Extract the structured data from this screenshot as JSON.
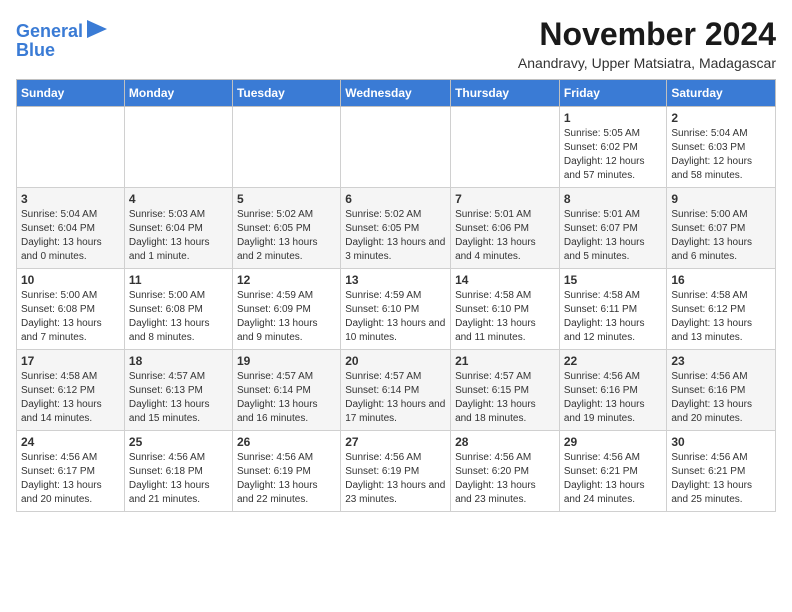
{
  "logo": {
    "line1": "General",
    "line2": "Blue"
  },
  "title": "November 2024",
  "location": "Anandravy, Upper Matsiatra, Madagascar",
  "headers": [
    "Sunday",
    "Monday",
    "Tuesday",
    "Wednesday",
    "Thursday",
    "Friday",
    "Saturday"
  ],
  "weeks": [
    [
      {
        "day": "",
        "sunrise": "",
        "sunset": "",
        "daylight": ""
      },
      {
        "day": "",
        "sunrise": "",
        "sunset": "",
        "daylight": ""
      },
      {
        "day": "",
        "sunrise": "",
        "sunset": "",
        "daylight": ""
      },
      {
        "day": "",
        "sunrise": "",
        "sunset": "",
        "daylight": ""
      },
      {
        "day": "",
        "sunrise": "",
        "sunset": "",
        "daylight": ""
      },
      {
        "day": "1",
        "sunrise": "Sunrise: 5:05 AM",
        "sunset": "Sunset: 6:02 PM",
        "daylight": "Daylight: 12 hours and 57 minutes."
      },
      {
        "day": "2",
        "sunrise": "Sunrise: 5:04 AM",
        "sunset": "Sunset: 6:03 PM",
        "daylight": "Daylight: 12 hours and 58 minutes."
      }
    ],
    [
      {
        "day": "3",
        "sunrise": "Sunrise: 5:04 AM",
        "sunset": "Sunset: 6:04 PM",
        "daylight": "Daylight: 13 hours and 0 minutes."
      },
      {
        "day": "4",
        "sunrise": "Sunrise: 5:03 AM",
        "sunset": "Sunset: 6:04 PM",
        "daylight": "Daylight: 13 hours and 1 minute."
      },
      {
        "day": "5",
        "sunrise": "Sunrise: 5:02 AM",
        "sunset": "Sunset: 6:05 PM",
        "daylight": "Daylight: 13 hours and 2 minutes."
      },
      {
        "day": "6",
        "sunrise": "Sunrise: 5:02 AM",
        "sunset": "Sunset: 6:05 PM",
        "daylight": "Daylight: 13 hours and 3 minutes."
      },
      {
        "day": "7",
        "sunrise": "Sunrise: 5:01 AM",
        "sunset": "Sunset: 6:06 PM",
        "daylight": "Daylight: 13 hours and 4 minutes."
      },
      {
        "day": "8",
        "sunrise": "Sunrise: 5:01 AM",
        "sunset": "Sunset: 6:07 PM",
        "daylight": "Daylight: 13 hours and 5 minutes."
      },
      {
        "day": "9",
        "sunrise": "Sunrise: 5:00 AM",
        "sunset": "Sunset: 6:07 PM",
        "daylight": "Daylight: 13 hours and 6 minutes."
      }
    ],
    [
      {
        "day": "10",
        "sunrise": "Sunrise: 5:00 AM",
        "sunset": "Sunset: 6:08 PM",
        "daylight": "Daylight: 13 hours and 7 minutes."
      },
      {
        "day": "11",
        "sunrise": "Sunrise: 5:00 AM",
        "sunset": "Sunset: 6:08 PM",
        "daylight": "Daylight: 13 hours and 8 minutes."
      },
      {
        "day": "12",
        "sunrise": "Sunrise: 4:59 AM",
        "sunset": "Sunset: 6:09 PM",
        "daylight": "Daylight: 13 hours and 9 minutes."
      },
      {
        "day": "13",
        "sunrise": "Sunrise: 4:59 AM",
        "sunset": "Sunset: 6:10 PM",
        "daylight": "Daylight: 13 hours and 10 minutes."
      },
      {
        "day": "14",
        "sunrise": "Sunrise: 4:58 AM",
        "sunset": "Sunset: 6:10 PM",
        "daylight": "Daylight: 13 hours and 11 minutes."
      },
      {
        "day": "15",
        "sunrise": "Sunrise: 4:58 AM",
        "sunset": "Sunset: 6:11 PM",
        "daylight": "Daylight: 13 hours and 12 minutes."
      },
      {
        "day": "16",
        "sunrise": "Sunrise: 4:58 AM",
        "sunset": "Sunset: 6:12 PM",
        "daylight": "Daylight: 13 hours and 13 minutes."
      }
    ],
    [
      {
        "day": "17",
        "sunrise": "Sunrise: 4:58 AM",
        "sunset": "Sunset: 6:12 PM",
        "daylight": "Daylight: 13 hours and 14 minutes."
      },
      {
        "day": "18",
        "sunrise": "Sunrise: 4:57 AM",
        "sunset": "Sunset: 6:13 PM",
        "daylight": "Daylight: 13 hours and 15 minutes."
      },
      {
        "day": "19",
        "sunrise": "Sunrise: 4:57 AM",
        "sunset": "Sunset: 6:14 PM",
        "daylight": "Daylight: 13 hours and 16 minutes."
      },
      {
        "day": "20",
        "sunrise": "Sunrise: 4:57 AM",
        "sunset": "Sunset: 6:14 PM",
        "daylight": "Daylight: 13 hours and 17 minutes."
      },
      {
        "day": "21",
        "sunrise": "Sunrise: 4:57 AM",
        "sunset": "Sunset: 6:15 PM",
        "daylight": "Daylight: 13 hours and 18 minutes."
      },
      {
        "day": "22",
        "sunrise": "Sunrise: 4:56 AM",
        "sunset": "Sunset: 6:16 PM",
        "daylight": "Daylight: 13 hours and 19 minutes."
      },
      {
        "day": "23",
        "sunrise": "Sunrise: 4:56 AM",
        "sunset": "Sunset: 6:16 PM",
        "daylight": "Daylight: 13 hours and 20 minutes."
      }
    ],
    [
      {
        "day": "24",
        "sunrise": "Sunrise: 4:56 AM",
        "sunset": "Sunset: 6:17 PM",
        "daylight": "Daylight: 13 hours and 20 minutes."
      },
      {
        "day": "25",
        "sunrise": "Sunrise: 4:56 AM",
        "sunset": "Sunset: 6:18 PM",
        "daylight": "Daylight: 13 hours and 21 minutes."
      },
      {
        "day": "26",
        "sunrise": "Sunrise: 4:56 AM",
        "sunset": "Sunset: 6:19 PM",
        "daylight": "Daylight: 13 hours and 22 minutes."
      },
      {
        "day": "27",
        "sunrise": "Sunrise: 4:56 AM",
        "sunset": "Sunset: 6:19 PM",
        "daylight": "Daylight: 13 hours and 23 minutes."
      },
      {
        "day": "28",
        "sunrise": "Sunrise: 4:56 AM",
        "sunset": "Sunset: 6:20 PM",
        "daylight": "Daylight: 13 hours and 23 minutes."
      },
      {
        "day": "29",
        "sunrise": "Sunrise: 4:56 AM",
        "sunset": "Sunset: 6:21 PM",
        "daylight": "Daylight: 13 hours and 24 minutes."
      },
      {
        "day": "30",
        "sunrise": "Sunrise: 4:56 AM",
        "sunset": "Sunset: 6:21 PM",
        "daylight": "Daylight: 13 hours and 25 minutes."
      }
    ]
  ]
}
